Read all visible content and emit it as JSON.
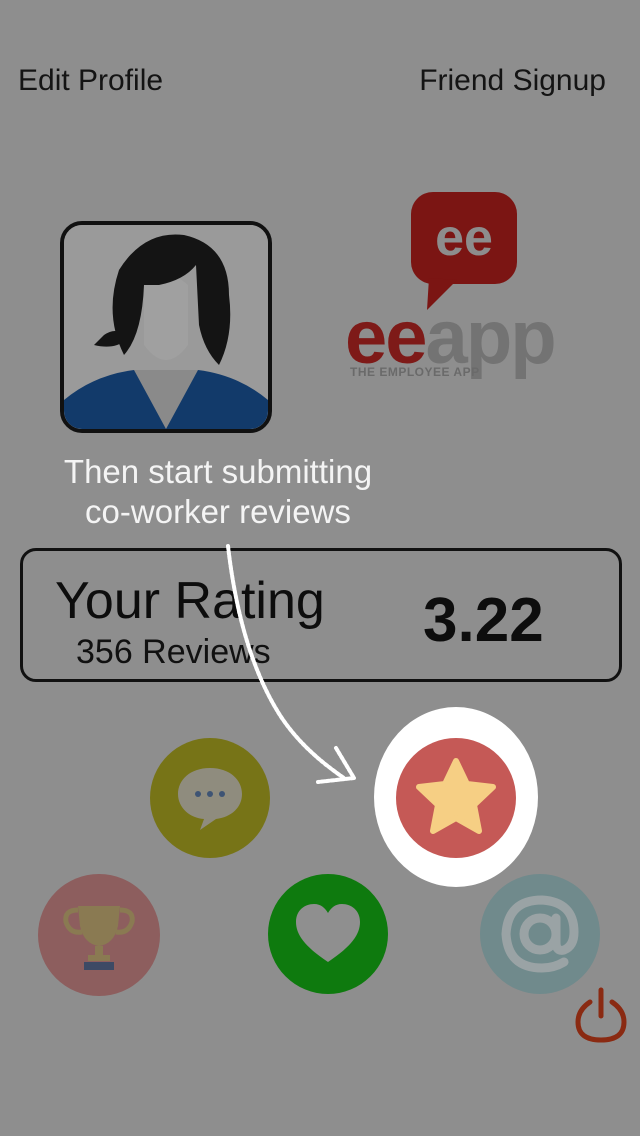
{
  "nav": {
    "edit_profile": "Edit Profile",
    "friend_signup": "Friend Signup"
  },
  "logo": {
    "bubble_text": "ee",
    "brand_ee": "ee",
    "brand_app": "app",
    "tagline": "THE EMPLOYEE APP",
    "colors": {
      "red": "#8a1f1c",
      "gray": "#737373"
    }
  },
  "tip": {
    "line1": "Then start submitting",
    "line2": "co-worker reviews"
  },
  "rating": {
    "title": "Your Rating",
    "reviews": "356 Reviews",
    "value": "3.22"
  },
  "actions": [
    {
      "name": "messages",
      "icon": "chat-bubble-icon",
      "color": "#777417"
    },
    {
      "name": "reviews",
      "icon": "star-icon",
      "color": "#c55956",
      "highlighted": true
    },
    {
      "name": "awards",
      "icon": "trophy-icon",
      "color": "#8d5e5e"
    },
    {
      "name": "favorites",
      "icon": "heart-icon",
      "color": "#0e7a0e"
    },
    {
      "name": "email",
      "icon": "at-sign-icon",
      "color": "#708a8c"
    },
    {
      "name": "logout",
      "icon": "power-icon",
      "color": "#8a2a12"
    }
  ]
}
